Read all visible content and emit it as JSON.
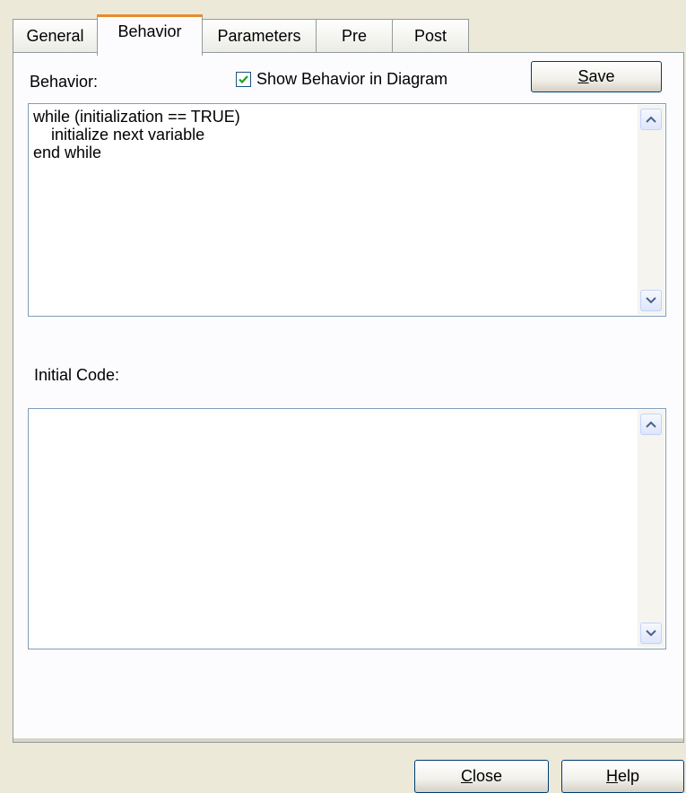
{
  "tabs": [
    {
      "label": "General",
      "active": false
    },
    {
      "label": "Behavior",
      "active": true
    },
    {
      "label": "Parameters",
      "active": false
    },
    {
      "label": "Pre",
      "active": false
    },
    {
      "label": "Post",
      "active": false
    }
  ],
  "behavior": {
    "label": "Behavior:",
    "show_in_diagram_label": "Show Behavior in Diagram",
    "show_in_diagram_checked": true,
    "save_label_accel": "S",
    "save_label_rest": "ave",
    "code": "while (initialization == TRUE)\n    initialize next variable\nend while"
  },
  "initial_code": {
    "label": "Initial Code:",
    "value": ""
  },
  "footer": {
    "close_accel": "C",
    "close_rest": "lose",
    "help_accel": "H",
    "help_rest": "elp"
  },
  "colors": {
    "dialog_bg": "#ece9d8",
    "panel_bg": "#fcfcfe",
    "active_tab_accent": "#e68b2c",
    "checkmark": "#21a121",
    "textbox_border": "#7f9db9",
    "button_border": "#003c74"
  },
  "icons": {
    "checkbox": "checkmark-icon",
    "scroll_up": "scroll-up-arrow-icon",
    "scroll_down": "scroll-down-arrow-icon"
  }
}
